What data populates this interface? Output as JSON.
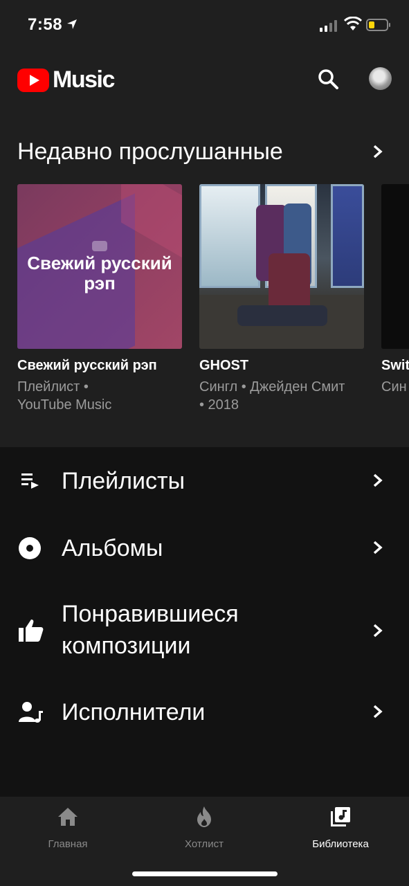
{
  "status_bar": {
    "time": "7:58"
  },
  "header": {
    "logo_text": "Music",
    "brand_color": "#ff0000"
  },
  "recent": {
    "title": "Недавно прослушанные",
    "cards": [
      {
        "art_label": "Свежий русский рэп",
        "name": "Свежий русский рэп",
        "sub_line1": "Плейлист •",
        "sub_line2": "YouTube Music"
      },
      {
        "name": "GHOST",
        "sub_line1": "Сингл • Джейден Смит",
        "sub_line2": "• 2018"
      },
      {
        "name": "Swit",
        "sub_line1": "Син"
      }
    ]
  },
  "library": {
    "items": [
      {
        "label": "Плейлисты",
        "icon": "playlist-icon"
      },
      {
        "label": "Альбомы",
        "icon": "album-icon"
      },
      {
        "label_line1": "Понравившиеся",
        "label_line2": "композиции",
        "icon": "thumb-up-icon"
      },
      {
        "label": "Исполнители",
        "icon": "artist-icon"
      }
    ]
  },
  "bottom_nav": {
    "tabs": [
      {
        "label": "Главная",
        "icon": "home-icon"
      },
      {
        "label": "Хотлист",
        "icon": "flame-icon"
      },
      {
        "label": "Библиотека",
        "icon": "library-icon",
        "active": true
      }
    ]
  }
}
